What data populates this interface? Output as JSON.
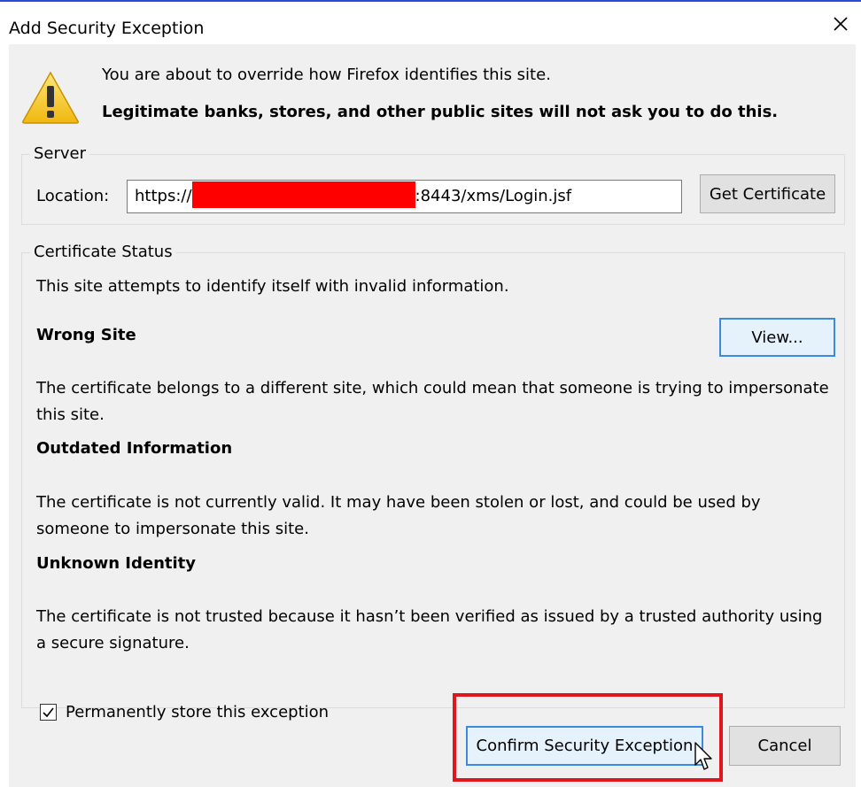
{
  "window": {
    "title": "Add Security Exception",
    "close_glyph": "✕"
  },
  "intro": {
    "line1": "You are about to override how Firefox identifies this site.",
    "line2": "Legitimate banks, stores, and other public sites will not ask you to do this."
  },
  "server": {
    "legend": "Server",
    "location_label": "Location:",
    "url_prefix": "https://",
    "url_suffix": ":8443/xms/Login.jsf",
    "get_certificate_label": "Get Certificate"
  },
  "certificate_status": {
    "legend": "Certificate Status",
    "summary": "This site attempts to identify itself with invalid information.",
    "view_label": "View...",
    "wrong_site_title": "Wrong Site",
    "wrong_site_text": "The certificate belongs to a different site, which could mean that someone is trying to impersonate this site.",
    "outdated_title": "Outdated Information",
    "outdated_text": "The certificate is not currently valid. It may have been stolen or lost, and could be used by someone to impersonate this site.",
    "unknown_title": "Unknown Identity",
    "unknown_text": "The certificate is not trusted because it hasn’t been verified as issued by a trusted authority using a secure signature."
  },
  "permanent_store": {
    "label": "Permanently store this exception",
    "checked": true
  },
  "buttons": {
    "confirm_label": "Confirm Security Exception",
    "cancel_label": "Cancel"
  },
  "colors": {
    "highlight": "#e0161d",
    "redaction": "#ff0000",
    "focus_border": "#3c8ae0",
    "dialog_background": "#f0f0f0"
  },
  "icons": {
    "warning": "warning-triangle-icon",
    "close": "close-icon",
    "checkmark": "checkmark-icon",
    "cursor": "mouse-pointer-icon"
  }
}
